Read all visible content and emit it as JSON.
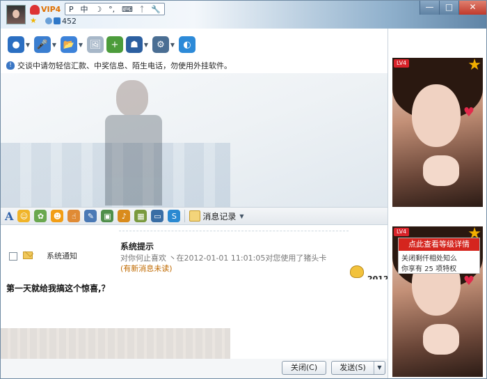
{
  "header": {
    "vip_badge": "VIP4",
    "level_count": "452",
    "ime_items": [
      "P",
      "中",
      "☽",
      "°,",
      "⌨",
      "ᛏ",
      "🔧"
    ]
  },
  "window_controls": {
    "minimize": "—",
    "maximize": "□",
    "close": "✕"
  },
  "toolbar": {
    "items": [
      {
        "icon": "webcam-icon",
        "color": "#2b6fc2",
        "glyph": "●",
        "has_caret": true
      },
      {
        "icon": "microphone-icon",
        "color": "#3a7ed0",
        "glyph": "🎤",
        "has_caret": true
      },
      {
        "icon": "folder-icon",
        "color": "#3c82d9",
        "glyph": "📂",
        "has_caret": true
      },
      {
        "icon": "image-icon",
        "color": "#a7b7c8",
        "glyph": "🖼",
        "has_caret": false
      },
      {
        "icon": "add-app-icon",
        "color": "#4c9c3b",
        "glyph": "+",
        "has_caret": false
      },
      {
        "icon": "police-icon",
        "color": "#2c5fa0",
        "glyph": "☗",
        "has_caret": true
      },
      {
        "icon": "settings-icon",
        "color": "#4a6e93",
        "glyph": "⚙",
        "has_caret": true
      },
      {
        "icon": "globe-icon",
        "color": "#2d8ad8",
        "glyph": "◐",
        "has_caret": false
      }
    ]
  },
  "notice": {
    "text": "交谈中请勿轻信汇款、中奖信息、陌生电话，勿使用外挂软件。"
  },
  "format_bar": {
    "font_label": "A",
    "icons": [
      {
        "icon": "smiley-icon",
        "color": "#f0b429",
        "glyph": "☺"
      },
      {
        "icon": "magic-emoji-icon",
        "color": "#6aa84f",
        "glyph": "✿"
      },
      {
        "icon": "wink-icon",
        "color": "#f29e16",
        "glyph": "☻"
      },
      {
        "icon": "thumb-icon",
        "color": "#e08b35",
        "glyph": "☝"
      },
      {
        "icon": "scribble-icon",
        "color": "#4a79b5",
        "glyph": "✎"
      },
      {
        "icon": "picture-icon",
        "color": "#4f8f4a",
        "glyph": "▣"
      },
      {
        "icon": "music-icon",
        "color": "#d98b1c",
        "glyph": "♪"
      },
      {
        "icon": "gift-icon",
        "color": "#7a9a3e",
        "glyph": "▦"
      },
      {
        "icon": "screenshot-icon",
        "color": "#3a6ea5",
        "glyph": "▭"
      },
      {
        "icon": "at-icon",
        "color": "#2b89d1",
        "glyph": "S"
      }
    ],
    "history_label": "消息记录"
  },
  "notification": {
    "label": "系统通知",
    "title": "系统提示",
    "description": "对你何止喜欢 丶在2012-01-01 11:01:05对您使用了猪头卡",
    "unread": "(有新消息未读)",
    "year": "2012"
  },
  "input": {
    "text": "第一天就给我搞这个惊喜,？"
  },
  "buttons": {
    "close": "关闭(C)",
    "send": "发送(S)"
  },
  "right_panel": {
    "top_level_badge": "LV4",
    "bottom_level_badge": "LV4",
    "level_tip_button": "点此查看等级详情",
    "level_tip_line1": "关闭剩仟相处知么",
    "level_tip_line2": "你享有 25 项特权"
  }
}
